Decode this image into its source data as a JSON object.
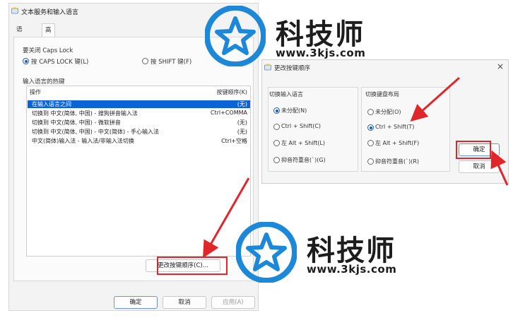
{
  "main_dialog": {
    "title": "文本服务和输入语言",
    "tabs": [
      "语言栏",
      "高级键设置"
    ],
    "caps_group": "要关闭 Caps Lock",
    "caps_options": [
      "按 CAPS LOCK 键(L)",
      "按 SHIFT 键(F)"
    ],
    "hotkeys_group": "输入语言的热键",
    "col_action": "操作",
    "col_keys": "按键顺序(K)",
    "rows": [
      {
        "action": "在输入语言之间",
        "keys": "(无)"
      },
      {
        "action": "切换到 中文(简体, 中国) - 搜狗拼音输入法",
        "keys": "Ctrl+COMMA"
      },
      {
        "action": "切换到 中文(简体, 中国) - 微软拼音",
        "keys": "(无)"
      },
      {
        "action": "切换到 中文(简体, 中国) - 中文(简体) - 手心输入法",
        "keys": "(无)"
      },
      {
        "action": "中文(简体)输入法 - 输入法/非输入法切换",
        "keys": "Ctrl+空格"
      }
    ],
    "change_sequence_button": "更改按键顺序(C)...",
    "ok": "确定",
    "cancel": "取消",
    "apply": "应用(A)"
  },
  "sub_dialog": {
    "title": "更改按键顺序",
    "left_group": "切换输入语言",
    "left_options": [
      "未分配(N)",
      "Ctrl + Shift(C)",
      "左 Alt + Shift(L)",
      "抑音符重音(`)(G)"
    ],
    "right_group": "切换键盘布局",
    "right_options": [
      "未分配(O)",
      "Ctrl + Shift(T)",
      "左 Alt + Shift(F)",
      "抑音符重音(`)(R)"
    ],
    "ok": "确定",
    "cancel": "取消"
  },
  "watermark": {
    "brand": "科技师",
    "url": "www.3kjs.com"
  },
  "colors": {
    "highlight": "#e0262b",
    "selection": "#0a64d6",
    "logo_blue": "#1e88d8"
  }
}
